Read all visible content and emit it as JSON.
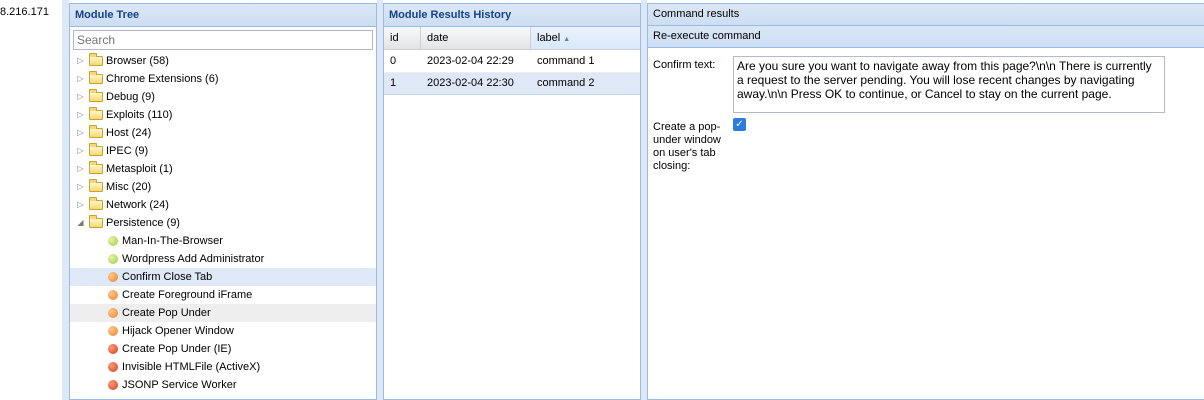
{
  "left_strip": {
    "ip_fragment": "8.216.171"
  },
  "module_tree": {
    "title": "Module Tree",
    "search_placeholder": "Search",
    "categories": [
      {
        "label": "Browser (58)"
      },
      {
        "label": "Chrome Extensions (6)"
      },
      {
        "label": "Debug (9)"
      },
      {
        "label": "Exploits (110)"
      },
      {
        "label": "Host (24)"
      },
      {
        "label": "IPEC (9)"
      },
      {
        "label": "Metasploit (1)"
      },
      {
        "label": "Misc (20)"
      },
      {
        "label": "Network (24)"
      },
      {
        "label": "Persistence (9)"
      }
    ],
    "persistence_modules": [
      {
        "label": "Man-In-The-Browser",
        "status": "green"
      },
      {
        "label": "Wordpress Add Administrator",
        "status": "green"
      },
      {
        "label": "Confirm Close Tab",
        "status": "orange"
      },
      {
        "label": "Create Foreground iFrame",
        "status": "orange"
      },
      {
        "label": "Create Pop Under",
        "status": "orange"
      },
      {
        "label": "Hijack Opener Window",
        "status": "orange"
      },
      {
        "label": "Create Pop Under (IE)",
        "status": "red"
      },
      {
        "label": "Invisible HTMLFile (ActiveX)",
        "status": "red"
      },
      {
        "label": "JSONP Service Worker",
        "status": "red"
      }
    ],
    "selected_module": "Confirm Close Tab",
    "hovered_module": "Create Pop Under",
    "status_colors": {
      "green": "#9ccc3c",
      "orange": "#ee7c2a",
      "red": "#d23c14"
    }
  },
  "results_history": {
    "title": "Module Results History",
    "columns": {
      "id": "id",
      "date": "date",
      "label": "label"
    },
    "sorted_column": "label",
    "rows": [
      {
        "id": "0",
        "date": "2023-02-04 22:29",
        "label": "command 1"
      },
      {
        "id": "1",
        "date": "2023-02-04 22:30",
        "label": "command 2"
      }
    ],
    "selected_row": 1
  },
  "command": {
    "results_header": "Command results",
    "reexecute_header": "Re-execute command",
    "confirm_text_label": "Confirm text:",
    "confirm_text_value": "Are you sure you want to navigate away from this page?\\n\\n There is currently a request to the server pending. You will lose recent changes by navigating away.\\n\\n Press OK to continue, or Cancel to stay on the current page.",
    "popunder_label": "Create a pop-under window on user's tab closing:",
    "popunder_checked": true
  },
  "colors": {
    "panel_header_text": "#15428b",
    "panel_border": "#99bbe8",
    "selection": "#dfe8f6",
    "checkbox": "#2f7ce0"
  }
}
